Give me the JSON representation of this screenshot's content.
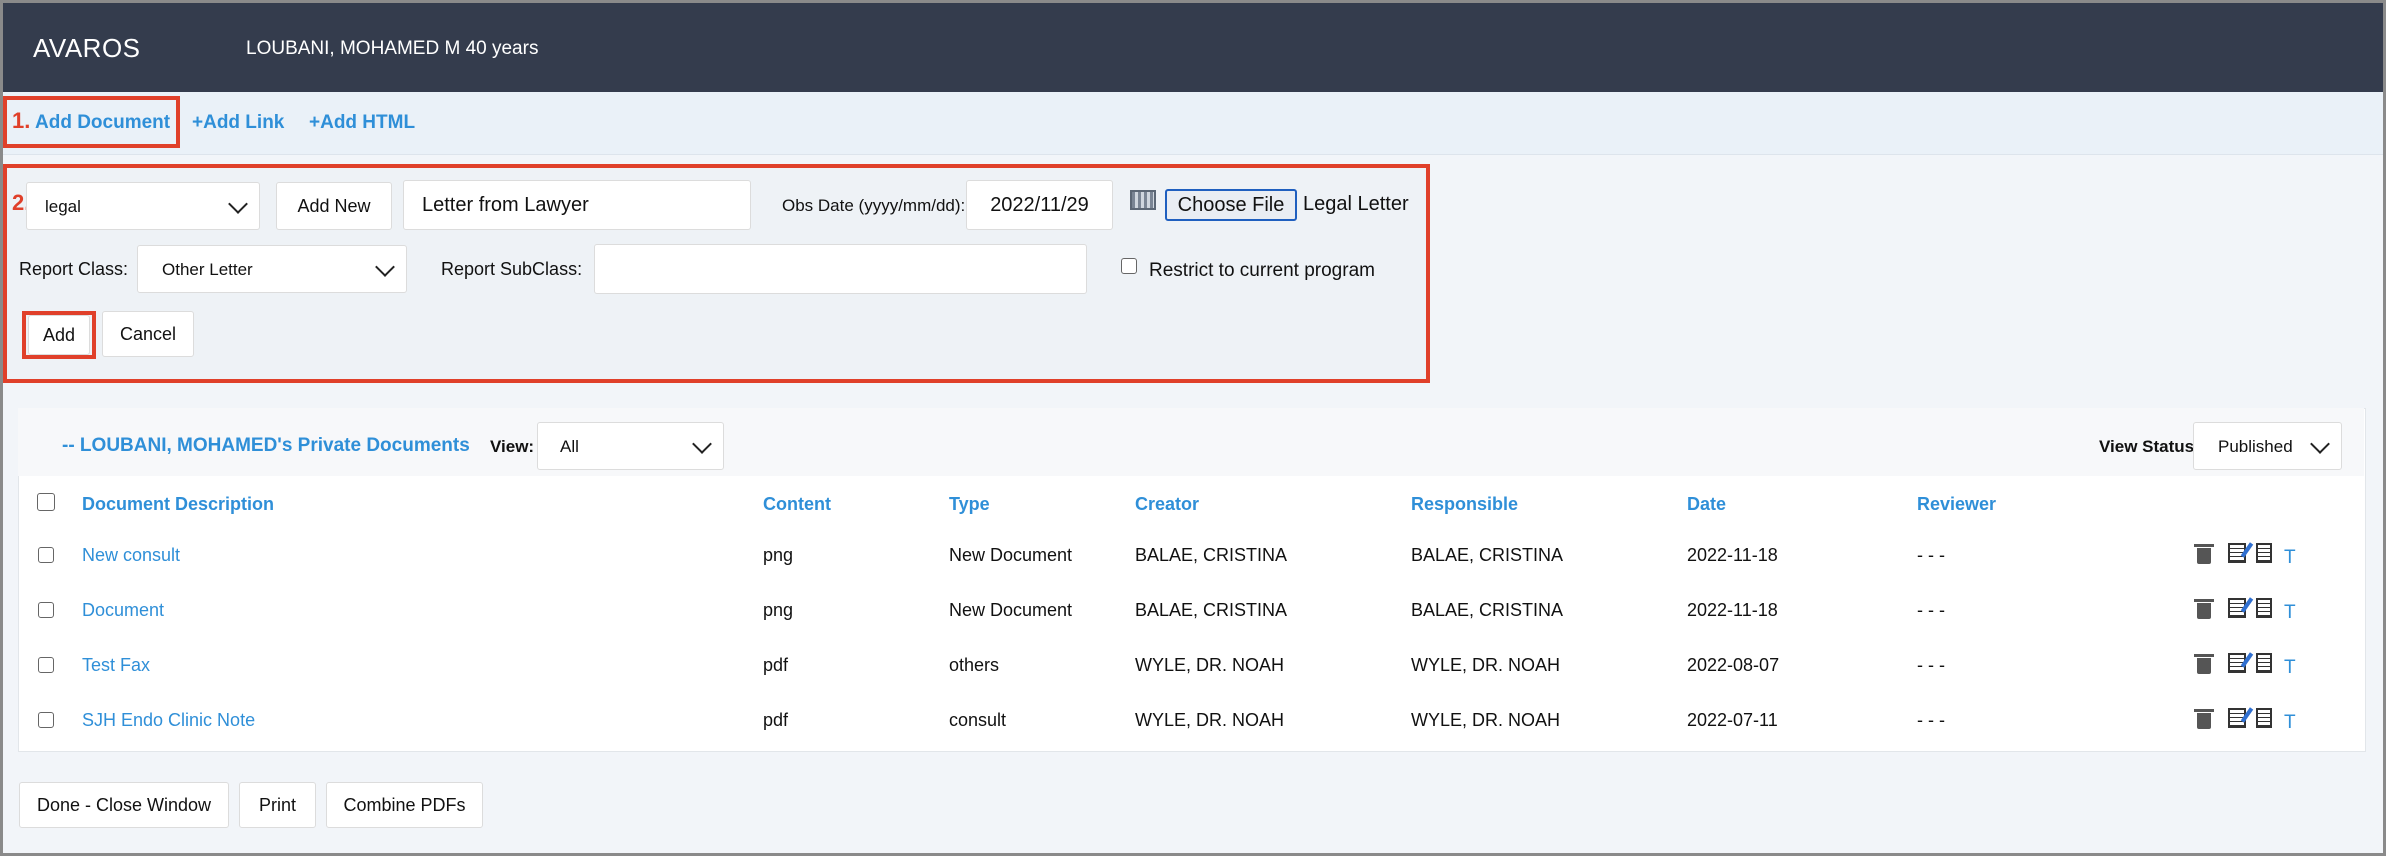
{
  "header": {
    "brand": "AVAROS",
    "patient": "LOUBANI, MOHAMED M 40 years"
  },
  "links": {
    "add_document": "Add Document",
    "add_link": "+Add Link",
    "add_html": "+Add HTML"
  },
  "annotations": {
    "step1": "1.",
    "step2": "2."
  },
  "form": {
    "doc_type_value": "legal",
    "add_new_label": "Add New",
    "description_value": "Letter from Lawyer",
    "obs_date_label": "Obs Date (yyyy/mm/dd):",
    "obs_date_value": "2022/11/29",
    "choose_file_label": "Choose File",
    "file_name": "Legal Letter",
    "report_class_label": "Report Class:",
    "report_class_value": "Other Letter",
    "report_subclass_label": "Report SubClass:",
    "report_subclass_value": "",
    "restrict_label": "Restrict to current program",
    "add_label": "Add",
    "cancel_label": "Cancel"
  },
  "documents": {
    "title": "-- LOUBANI, MOHAMED's Private Documents",
    "view_label": "View:",
    "view_value": "All",
    "view_status_label": "View Status",
    "view_status_value": "Published",
    "columns": [
      "Document Description",
      "Content",
      "Type",
      "Creator",
      "Responsible",
      "Date",
      "Reviewer"
    ],
    "rows": [
      {
        "description": "New consult",
        "content": "png",
        "type": "New Document",
        "creator": "BALAE, CRISTINA",
        "responsible": "BALAE, CRISTINA",
        "date": "2022-11-18",
        "reviewer": "- - -",
        "t": "T"
      },
      {
        "description": "Document",
        "content": "png",
        "type": "New Document",
        "creator": "BALAE, CRISTINA",
        "responsible": "BALAE, CRISTINA",
        "date": "2022-11-18",
        "reviewer": "- - -",
        "t": "T"
      },
      {
        "description": "Test Fax",
        "content": "pdf",
        "type": "others",
        "creator": "WYLE, DR. NOAH",
        "responsible": "WYLE, DR. NOAH",
        "date": "2022-08-07",
        "reviewer": "- - -",
        "t": "T"
      },
      {
        "description": "SJH Endo Clinic Note",
        "content": "pdf",
        "type": "consult",
        "creator": "WYLE, DR. NOAH",
        "responsible": "WYLE, DR. NOAH",
        "date": "2022-07-11",
        "reviewer": "- - -",
        "t": "T"
      }
    ]
  },
  "footer": {
    "done_label": "Done - Close Window",
    "print_label": "Print",
    "combine_label": "Combine PDFs"
  },
  "colors": {
    "accent": "#2f8fd8",
    "header_bg": "#343c4d",
    "highlight": "#e0402a"
  },
  "icons": [
    "trash-icon",
    "edit-icon",
    "document-icon",
    "calendar-icon",
    "chevron-down-icon"
  ]
}
